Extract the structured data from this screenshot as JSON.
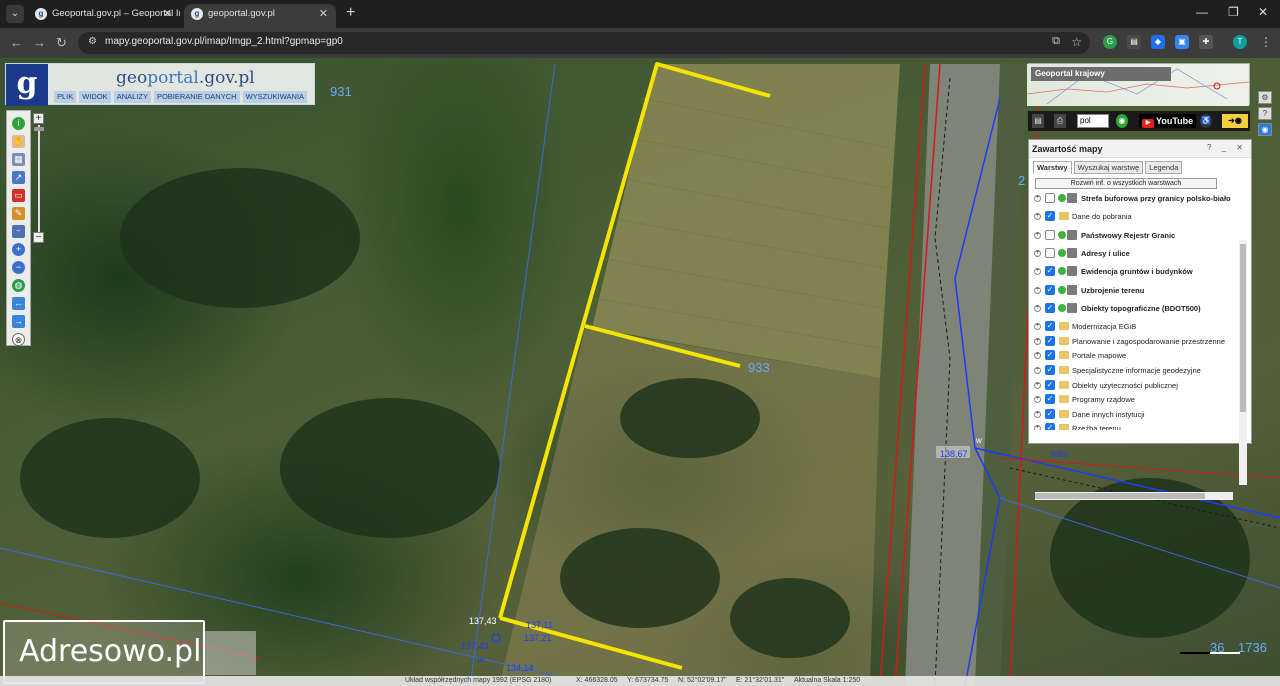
{
  "browser": {
    "tabs": [
      {
        "title": "Geoportal.gov.pl – Geoportal Inf",
        "active": false
      },
      {
        "title": "geoportal.gov.pl",
        "active": true
      }
    ],
    "new_tab": "+",
    "url": "mapy.geoportal.gov.pl/imap/Imgp_2.html?gpmap=gp0",
    "profile_initial": "T",
    "window_controls": {
      "minimize": "—",
      "maximize": "❐",
      "close": "✕"
    }
  },
  "geoportal": {
    "brand_prefix": "geo",
    "brand_accent": "portal",
    "brand_suffix": ".gov.pl",
    "logo_letter": "g",
    "menu": [
      "PLIK",
      "WIDOK",
      "ANALIZY",
      "POBIERANIE DANYCH",
      "WYSZUKIWANIA"
    ]
  },
  "toolbar": {
    "icons": [
      "info-icon",
      "pan-hand-icon",
      "grid-icon",
      "select-icon",
      "rect-select-icon",
      "pencil-icon",
      "measure-icon",
      "zoom-in-icon",
      "zoom-out-icon",
      "globe-icon",
      "back-arrow-icon",
      "forward-arrow-icon",
      "reset-icon"
    ]
  },
  "krajowy": {
    "label": "Geoportal krajowy"
  },
  "extbar": {
    "lang": "pol",
    "youtube": "YouTube"
  },
  "layers_panel": {
    "title": "Zawartość mapy",
    "header_buttons": "? _ ✕",
    "tabs": [
      "Warstwy",
      "Wyszukaj warstwę",
      "Legenda"
    ],
    "expand_all": "Rozwiń inf. o wszystkich warstwach",
    "items": [
      {
        "label": "Strefa buforowa przy granicy polsko-biało",
        "checked": false,
        "bold": true,
        "type": "service"
      },
      {
        "label": "Dane do pobrania",
        "checked": true,
        "bold": false,
        "type": "folder"
      },
      {
        "label": "Państwowy Rejestr Granic",
        "checked": false,
        "bold": true,
        "type": "service"
      },
      {
        "label": "Adresy i ulice",
        "checked": false,
        "bold": true,
        "type": "service"
      },
      {
        "label": "Ewidencja gruntów i budynków",
        "checked": true,
        "bold": true,
        "type": "service"
      },
      {
        "label": "Uzbrojenie terenu",
        "checked": true,
        "bold": true,
        "type": "service"
      },
      {
        "label": "Obiekty topograficzne (BDOT500)",
        "checked": true,
        "bold": true,
        "type": "service"
      },
      {
        "label": "Modernizacja EGiB",
        "checked": true,
        "bold": false,
        "type": "folder"
      },
      {
        "label": "Planowanie i zagospodarowanie przestrzenne",
        "checked": true,
        "bold": false,
        "type": "folder"
      },
      {
        "label": "Portale mapowe",
        "checked": true,
        "bold": false,
        "type": "folder"
      },
      {
        "label": "Specjalistyczne informacje geodezyjne",
        "checked": true,
        "bold": false,
        "type": "folder"
      },
      {
        "label": "Obiekty użyteczności publicznej",
        "checked": true,
        "bold": false,
        "type": "folder"
      },
      {
        "label": "Programy rządowe",
        "checked": true,
        "bold": false,
        "type": "folder"
      },
      {
        "label": "Dane innych instytucji",
        "checked": true,
        "bold": false,
        "type": "folder"
      },
      {
        "label": "Rzeźba terenu",
        "checked": true,
        "bold": false,
        "type": "folder"
      }
    ]
  },
  "map_labels": {
    "parcel_931": "931",
    "parcel_933": "933",
    "elev_138_67": "138,67",
    "elev_137_43a": "137,43",
    "elev_137_43b": "137,43",
    "elev_137_21": "137,21",
    "elev_137_11": "137,11",
    "elev_134_14": "134,14",
    "code_w": "w",
    "code_wb": "w",
    "label_2": "2",
    "label_6050": "6050",
    "label_36": "36",
    "label_1736": "1736"
  },
  "watermark": "Adresowo.pl",
  "status": {
    "system": "Układ współrzędnych mapy 1992 (EPSG 2180)",
    "x": "X: 466328.05",
    "y": "Y: 673734.75",
    "n": "N: 52°02'09.17\"",
    "e": "E: 21°32'01.31\"",
    "scale": "Aktualna Skala 1:250"
  },
  "colors": {
    "parcel_line": "#f5e400",
    "boundary_blue": "#1a3cff",
    "boundary_red": "#d11a1a",
    "label_blue": "#2a55d6",
    "accent": "#1b3a8c"
  }
}
